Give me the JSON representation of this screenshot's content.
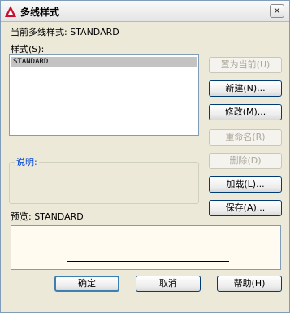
{
  "window": {
    "title": "多线样式",
    "close_glyph": "✕"
  },
  "current_style": "当前多线样式: STANDARD",
  "styles_label": "样式(S):",
  "styles_list": [
    "STANDARD"
  ],
  "buttons": {
    "set_current": "置为当前(U)",
    "new": "新建(N)...",
    "modify": "修改(M)...",
    "rename": "重命名(R)",
    "delete": "删除(D)",
    "load": "加载(L)...",
    "save": "保存(A)..."
  },
  "description_label": "说明:",
  "preview_label": "预览: STANDARD",
  "footer": {
    "ok": "确定",
    "cancel": "取消",
    "help": "帮助(H)"
  },
  "colors": {
    "description_label": "#0046d5",
    "selection": "#c3c3c3",
    "preview_bg": "#fffbf0"
  }
}
